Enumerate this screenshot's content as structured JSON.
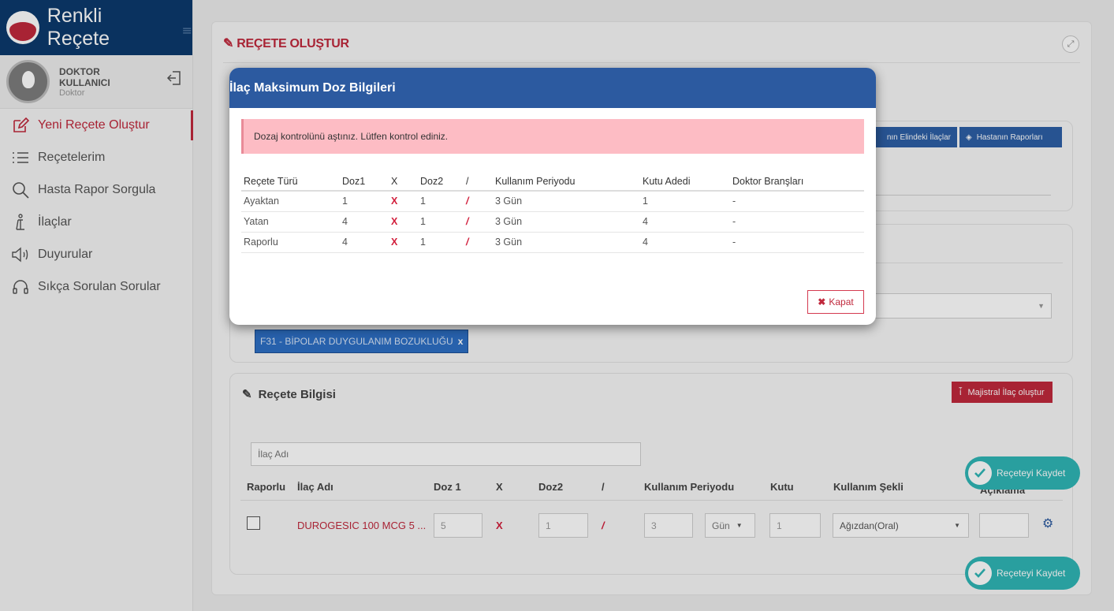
{
  "sidebar": {
    "brand": "Renkli Reçete",
    "user_name": "DOKTOR KULLANICI",
    "user_role": "Doktor",
    "items": [
      {
        "label": "Yeni Reçete Oluştur",
        "icon": "edit-icon",
        "active": true
      },
      {
        "label": "Reçetelerim",
        "icon": "list-icon"
      },
      {
        "label": "Hasta Rapor Sorgula",
        "icon": "search-icon"
      },
      {
        "label": "İlaçlar",
        "icon": "pill-icon"
      },
      {
        "label": "Duyurular",
        "icon": "megaphone-icon"
      },
      {
        "label": "Sıkça Sorulan Sorular",
        "icon": "headset-icon"
      }
    ]
  },
  "main": {
    "title": "REÇETE OLUŞTUR",
    "buttons": {
      "patient_drugs": "nın Elindeki İlaçlar",
      "patient_reports": "Hastanın Raporları",
      "majistral": "Majistral İlaç oluştur"
    },
    "diagnosis_tag": "F31 - BİPOLAR DUYGULANIM BOZUKLUĞU",
    "diagnosis_tag_remove": "x",
    "prescription_section": "Reçete Bilgisi",
    "drug_search_placeholder": "İlaç Adı",
    "grid_headers": {
      "raporlu": "Raporlu",
      "ilac_adi": "İlaç Adı",
      "doz1": "Doz 1",
      "x": "X",
      "doz2": "Doz2",
      "slash": "/",
      "kullanim_periyodu": "Kullanım Periyodu",
      "kutu": "Kutu",
      "kullanim_sekli": "Kullanım Şekli",
      "aciklama": "Açıklama"
    },
    "row": {
      "drug_name": "DUROGESIC 100 MCG 5 ...",
      "doz1": "5",
      "x": "X",
      "doz2": "1",
      "slash": "/",
      "period": "3",
      "period_unit": "Gün",
      "kutu": "1",
      "usage": "Ağızdan(Oral)",
      "aciklama": ""
    },
    "save_label": "Reçeteyi Kaydet"
  },
  "modal": {
    "title": "İlaç Maksimum Doz Bilgileri",
    "alert": "Dozaj kontrolünü aştınız. Lütfen kontrol ediniz.",
    "headers": [
      "Reçete Türü",
      "Doz1",
      "X",
      "Doz2",
      "/",
      "Kullanım Periyodu",
      "Kutu Adedi",
      "Doktor Branşları"
    ],
    "rows": [
      [
        "Ayaktan",
        "1",
        "X",
        "1",
        "/",
        "3 Gün",
        "1",
        "-"
      ],
      [
        "Yatan",
        "4",
        "X",
        "1",
        "/",
        "3 Gün",
        "4",
        "-"
      ],
      [
        "Raporlu",
        "4",
        "X",
        "1",
        "/",
        "3 Gün",
        "4",
        "-"
      ]
    ],
    "close_label": "Kapat"
  },
  "colors": {
    "brand": "#0c3a6d",
    "accent": "#c0283c",
    "primary": "#2c5aa0",
    "alert_bg": "#fdbcc4",
    "save": "#2fb6b6"
  }
}
